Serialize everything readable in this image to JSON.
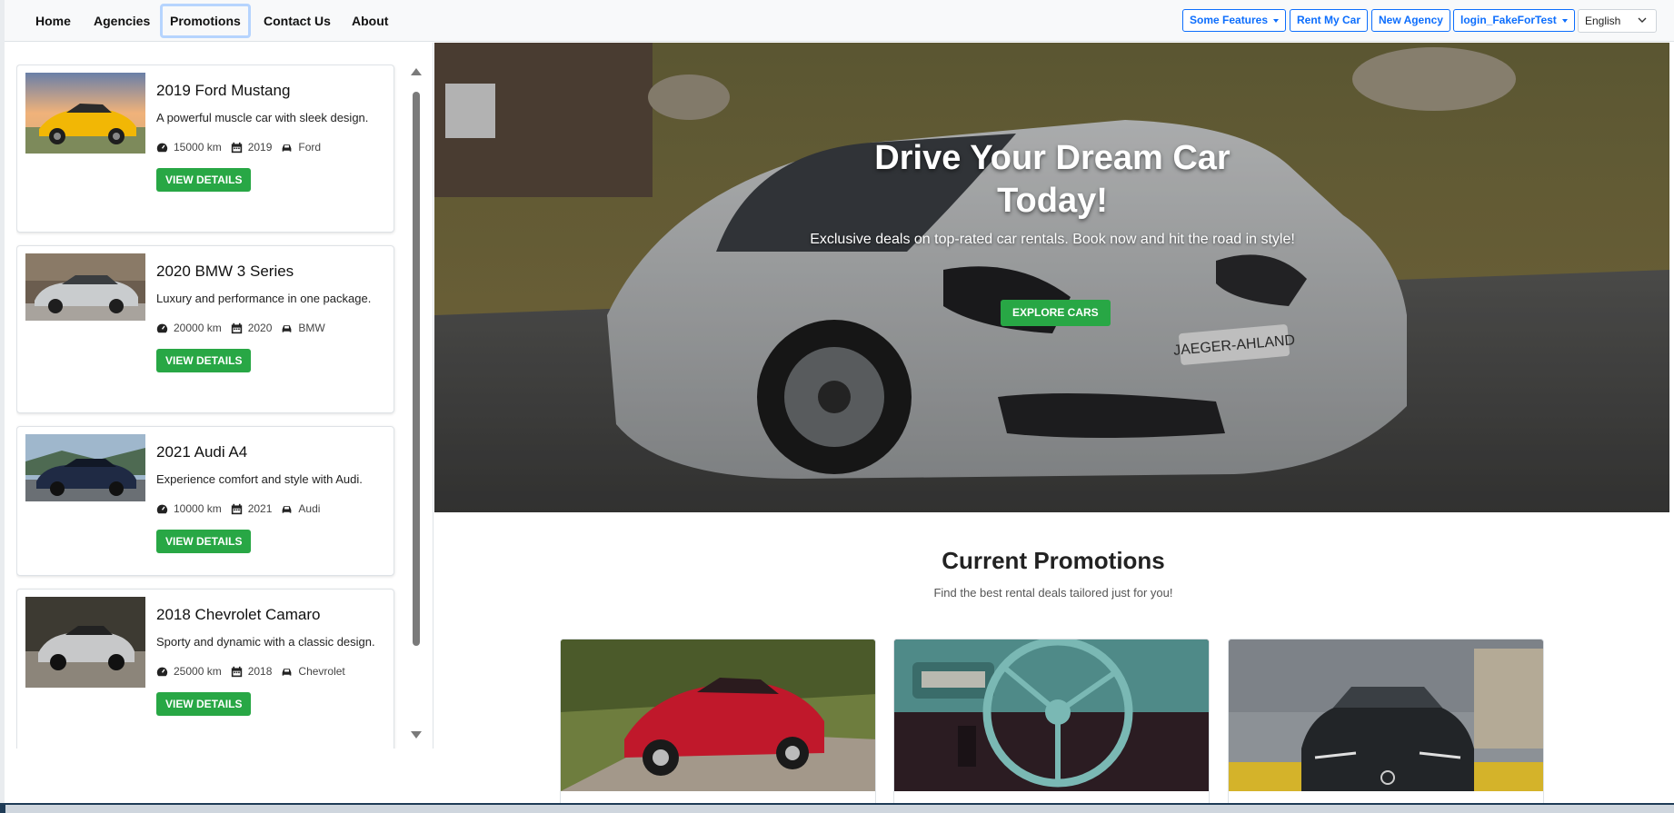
{
  "nav": {
    "links": [
      "Home",
      "Agencies",
      "Promotions",
      "Contact Us",
      "About"
    ],
    "active": "Promotions",
    "buttons": {
      "features": "Some Features",
      "rent": "Rent My Car",
      "agency": "New Agency",
      "login": "login_FakeForTest"
    },
    "language": "English"
  },
  "sidebar": {
    "cars": [
      {
        "title": "2019 Ford Mustang",
        "desc": "A powerful muscle car with sleek design.",
        "km": "15000 km",
        "year": "2019",
        "make": "Ford",
        "button": "VIEW DETAILS"
      },
      {
        "title": "2020 BMW 3 Series",
        "desc": "Luxury and performance in one package.",
        "km": "20000 km",
        "year": "2020",
        "make": "BMW",
        "button": "VIEW DETAILS"
      },
      {
        "title": "2021 Audi A4",
        "desc": "Experience comfort and style with Audi.",
        "km": "10000 km",
        "year": "2021",
        "make": "Audi",
        "button": "VIEW DETAILS"
      },
      {
        "title": "2018 Chevrolet Camaro",
        "desc": "Sporty and dynamic with a classic design.",
        "km": "25000 km",
        "year": "2018",
        "make": "Chevrolet",
        "button": "VIEW DETAILS"
      }
    ]
  },
  "hero": {
    "title": "Drive Your Dream Car Today!",
    "subtitle": "Exclusive deals on top-rated car rentals. Book now and hit the road in style!",
    "button": "EXPLORE CARS",
    "plate": "JAEGER-AHLAND"
  },
  "promotions": {
    "heading": "Current Promotions",
    "subheading": "Find the best rental deals tailored just for you!"
  },
  "colors": {
    "primary": "#0d6efd",
    "success": "#28a745",
    "navbar_bg": "#f8f9fa"
  }
}
